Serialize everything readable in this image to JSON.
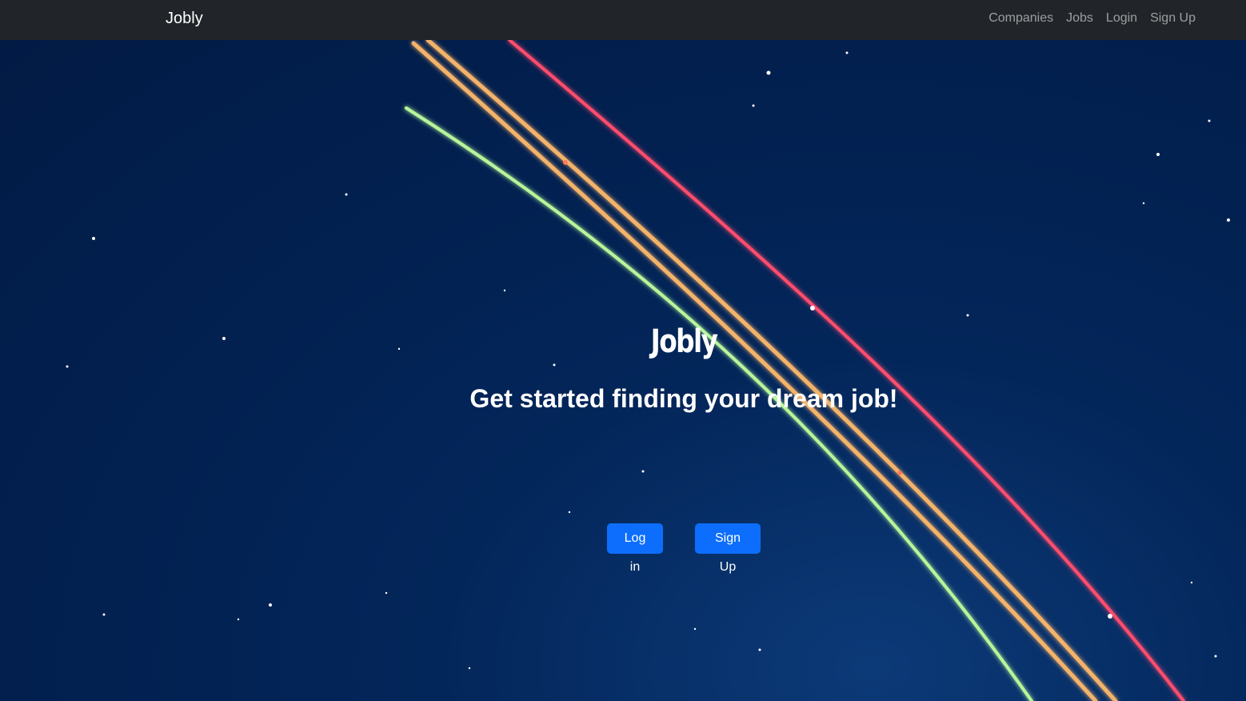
{
  "navbar": {
    "brand": "Jobly",
    "links": [
      "Companies",
      "Jobs",
      "Login",
      "Sign Up"
    ]
  },
  "hero": {
    "title": "Jobly",
    "subtitle": "Get started finding your dream job!",
    "login_button": "Log in",
    "signup_button": "Sign Up"
  },
  "colors": {
    "navbar_bg": "#212529",
    "hero_bg": "#03265a",
    "button_primary": "#0d6efd",
    "light_trail_red": "#ff4d6d",
    "light_trail_orange": "#f4b36a",
    "light_trail_green": "#b8f59a"
  }
}
